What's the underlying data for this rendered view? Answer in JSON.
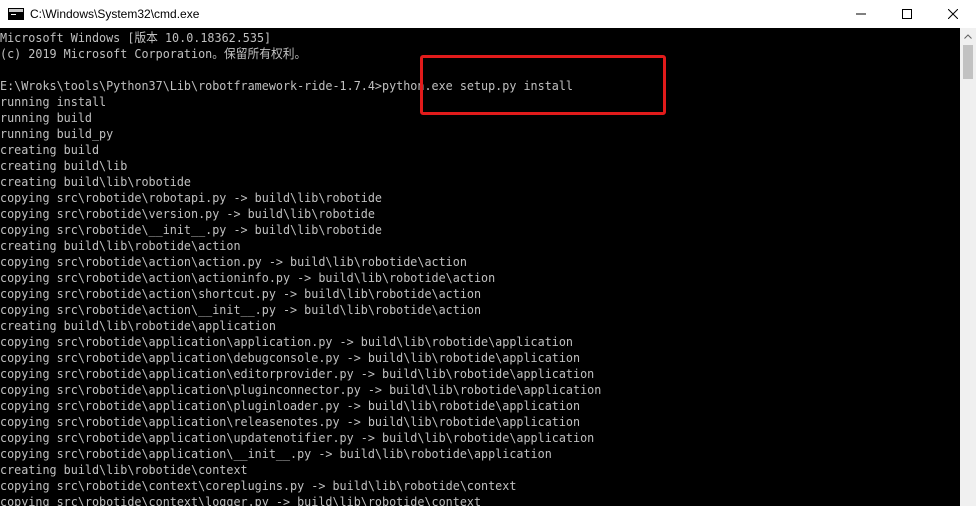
{
  "window": {
    "title": "C:\\Windows\\System32\\cmd.exe",
    "icon": "cmd-icon",
    "controls": [
      "minimize-icon",
      "maximize-icon",
      "close-icon"
    ]
  },
  "console": {
    "lines": [
      "Microsoft Windows [版本 10.0.18362.535]",
      "(c) 2019 Microsoft Corporation。保留所有权利。",
      "",
      "E:\\Wroks\\tools\\Python37\\Lib\\robotframework-ride-1.7.4>python.exe setup.py install",
      "running install",
      "running build",
      "running build_py",
      "creating build",
      "creating build\\lib",
      "creating build\\lib\\robotide",
      "copying src\\robotide\\robotapi.py -> build\\lib\\robotide",
      "copying src\\robotide\\version.py -> build\\lib\\robotide",
      "copying src\\robotide\\__init__.py -> build\\lib\\robotide",
      "creating build\\lib\\robotide\\action",
      "copying src\\robotide\\action\\action.py -> build\\lib\\robotide\\action",
      "copying src\\robotide\\action\\actioninfo.py -> build\\lib\\robotide\\action",
      "copying src\\robotide\\action\\shortcut.py -> build\\lib\\robotide\\action",
      "copying src\\robotide\\action\\__init__.py -> build\\lib\\robotide\\action",
      "creating build\\lib\\robotide\\application",
      "copying src\\robotide\\application\\application.py -> build\\lib\\robotide\\application",
      "copying src\\robotide\\application\\debugconsole.py -> build\\lib\\robotide\\application",
      "copying src\\robotide\\application\\editorprovider.py -> build\\lib\\robotide\\application",
      "copying src\\robotide\\application\\pluginconnector.py -> build\\lib\\robotide\\application",
      "copying src\\robotide\\application\\pluginloader.py -> build\\lib\\robotide\\application",
      "copying src\\robotide\\application\\releasenotes.py -> build\\lib\\robotide\\application",
      "copying src\\robotide\\application\\updatenotifier.py -> build\\lib\\robotide\\application",
      "copying src\\robotide\\application\\__init__.py -> build\\lib\\robotide\\application",
      "creating build\\lib\\robotide\\context",
      "copying src\\robotide\\context\\coreplugins.py -> build\\lib\\robotide\\context",
      "copying src\\robotide\\context\\logger.py -> build\\lib\\robotide\\context"
    ]
  },
  "colors": {
    "console_bg": "#000000",
    "console_text": "#c0c0c0",
    "highlight": "#e11b1b"
  }
}
